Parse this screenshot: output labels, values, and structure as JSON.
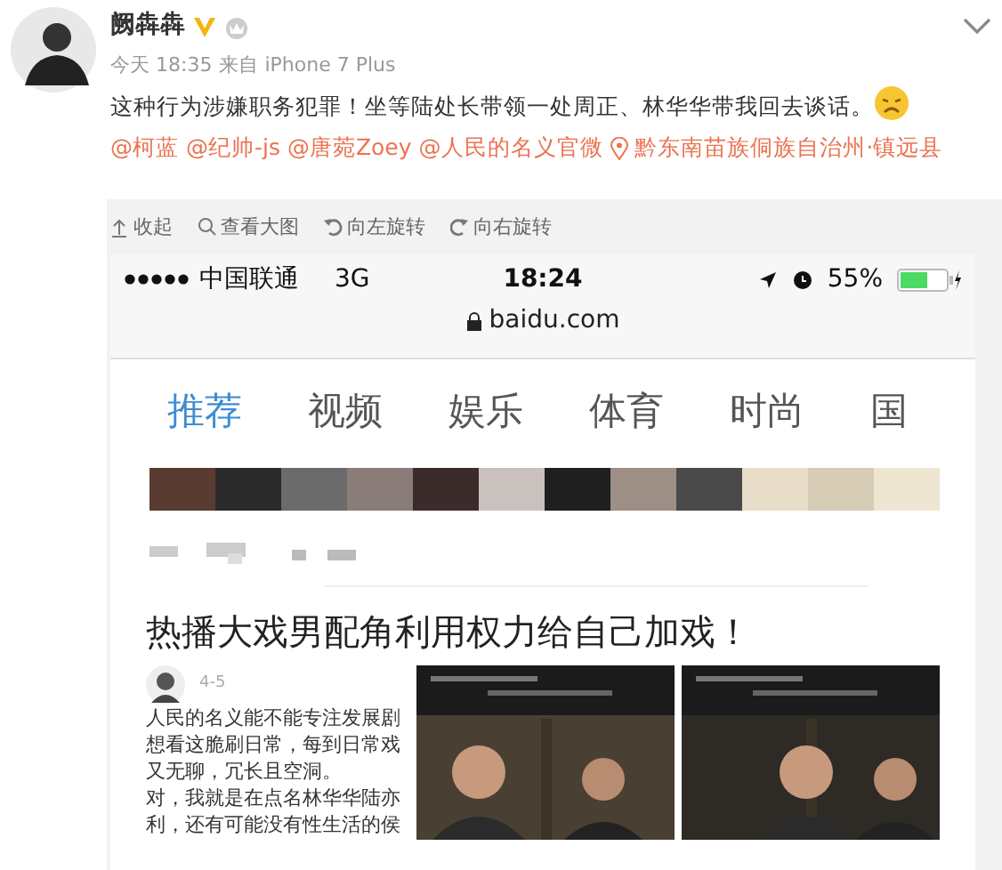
{
  "post": {
    "author": "阙犇犇",
    "verified": true,
    "member": true,
    "time": "今天 18:35",
    "source": "来自 iPhone 7 Plus",
    "segments": [
      {
        "kind": "text",
        "text": "这种行为涉嫌职务犯罪！坐等陆处长带领一处周正、林华华带我回去谈话。"
      },
      {
        "kind": "emoji"
      },
      {
        "kind": "mention",
        "text": "@柯蓝"
      },
      {
        "kind": "mention",
        "text": "@纪帅-js"
      },
      {
        "kind": "mention",
        "text": "@唐菀Zoey"
      },
      {
        "kind": "mention",
        "text": "@人民的名义官微"
      },
      {
        "kind": "location",
        "text": "黔东南苗族侗族自治州·镇远县"
      }
    ]
  },
  "image_toolbar": [
    {
      "kind": "collapse",
      "label": "收起"
    },
    {
      "kind": "zoom",
      "label": "查看大图"
    },
    {
      "kind": "rotate-left",
      "label": "向左旋转"
    },
    {
      "kind": "rotate-right",
      "label": "向右旋转"
    }
  ],
  "phone": {
    "status_bar": {
      "carrier": "中国联通",
      "network": "3G",
      "time": "18:24",
      "battery": "55%"
    },
    "url": "baidu.com",
    "tabs": [
      {
        "label": "推荐",
        "selected": true
      },
      {
        "label": "视频",
        "selected": false
      },
      {
        "label": "娱乐",
        "selected": false
      },
      {
        "label": "体育",
        "selected": false
      },
      {
        "label": "时尚",
        "selected": false
      },
      {
        "label": "国",
        "selected": false
      }
    ],
    "article": {
      "headline": "热播大戏男配角利用权力给自己加戏！",
      "date": "4-5",
      "lines": [
        "人民的名义能不能专注发展剧",
        "想看这脆刷日常，每到日常戏",
        "又无聊，冗长且空洞。",
        "对，我就是在点名林华华陆亦",
        "利，还有可能没有性生活的侯"
      ]
    }
  }
}
